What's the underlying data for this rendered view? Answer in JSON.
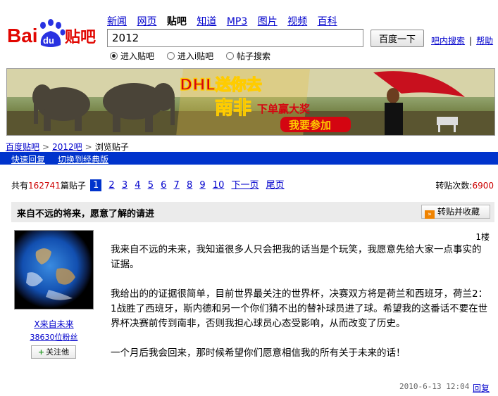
{
  "logo": {
    "text_left": "Bai",
    "text_badge": "du",
    "text_right": "贴吧"
  },
  "nav": [
    "新闻",
    "网页",
    "贴吧",
    "知道",
    "MP3",
    "图片",
    "视频",
    "百科"
  ],
  "nav_current": 2,
  "search": {
    "value": "2012",
    "button": "百度一下"
  },
  "side_links": {
    "in_bar_search": "吧内搜索",
    "help": "帮助"
  },
  "radios": [
    {
      "label": "进入贴吧",
      "checked": true
    },
    {
      "label": "进入i贴吧",
      "checked": false
    },
    {
      "label": "帖子搜索",
      "checked": false
    }
  ],
  "banner": {
    "headline": "DHL送你去",
    "sub1": "南非",
    "sub2": "下单赢大奖",
    "cta": "我要参加"
  },
  "breadcrumb": {
    "home": "百度贴吧",
    "bar": "2012吧",
    "current": "浏览贴子"
  },
  "bluebar": {
    "quick_reply": "快速回复",
    "classic": "切换到经典版"
  },
  "stats": {
    "prefix": "共有",
    "count": "162741",
    "suffix": "篇贴子",
    "repost_label": "转贴次数:",
    "repost_count": "6900"
  },
  "pager": {
    "pages": [
      "1",
      "2",
      "3",
      "4",
      "5",
      "6",
      "7",
      "8",
      "9",
      "10"
    ],
    "current": 0,
    "next": "下一页",
    "last": "尾页"
  },
  "thread": {
    "title": "来自不远的将来，愿意了解的请进",
    "fav_button": "转贴并收藏",
    "fav_icon": "»"
  },
  "author": {
    "name": "X来自未来",
    "fans": "38630位粉丝",
    "follow": "关注他",
    "follow_plus": "+"
  },
  "post": {
    "floor": "1楼",
    "paragraphs": [
      "我来自不远的未来，我知道很多人只会把我的话当是个玩笑，我愿意先给大家一点事实的证据。",
      "我给出的的证据很简单，目前世界最关注的世界杯，决赛双方将是荷兰和西班牙，荷兰2：1战胜了西班牙，斯内德和另一个你们猜不出的替补球员进了球。希望我的这番话不要在世界杯决赛前传到南非，否则我担心球员心态受影响，从而改变了历史。",
      "一个月后我会回来，那时候希望你们愿意相信我的所有关于未来的话！"
    ],
    "time": "2010-6-13 12:04",
    "reply": "回复"
  },
  "colors": {
    "link": "#0000cc",
    "bluebar": "#0033cc",
    "red": "#cc0000",
    "logo_red": "#e10601",
    "logo_blue": "#2932e1"
  }
}
